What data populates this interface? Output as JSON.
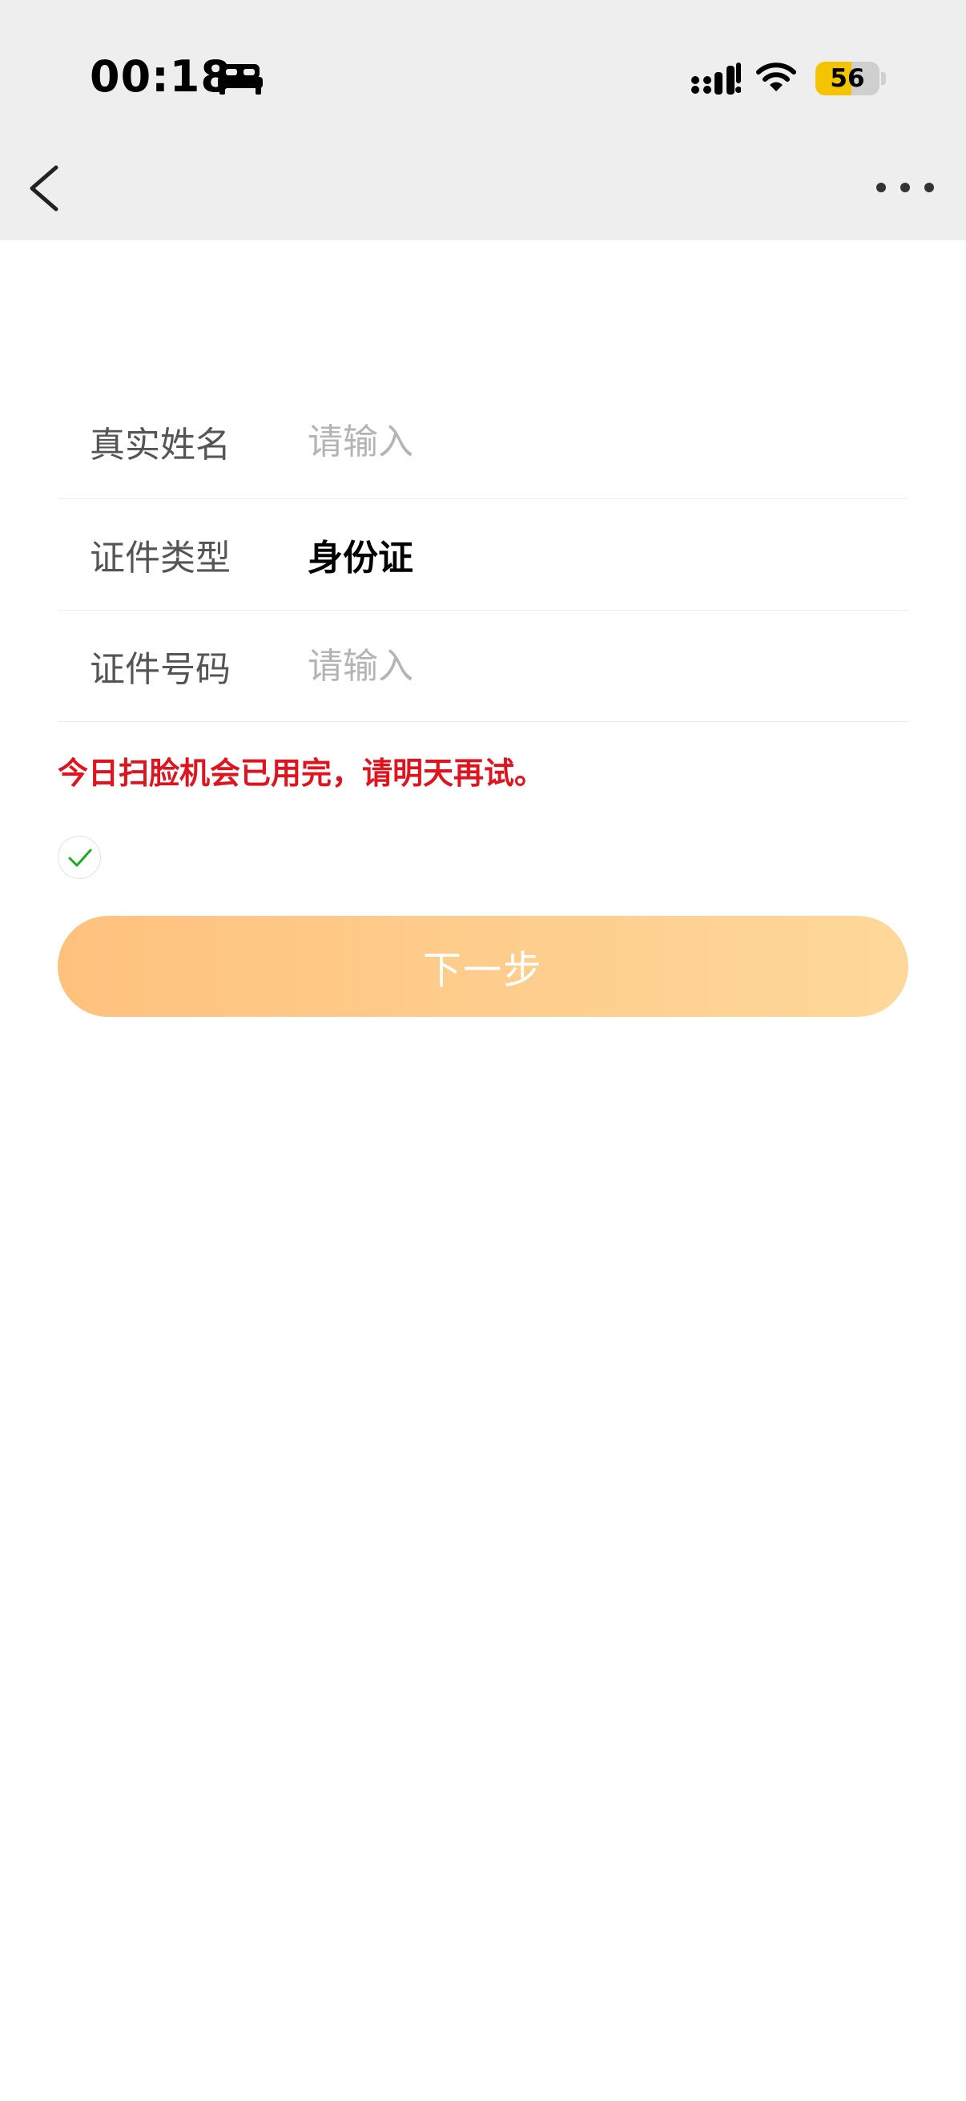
{
  "status_bar": {
    "time": "00:18",
    "battery_level": "56",
    "battery_fraction": 0.56,
    "battery_color": "#f5c400",
    "icons": [
      "bed-icon",
      "signal-icon",
      "wifi-icon",
      "battery-icon"
    ]
  },
  "nav": {
    "back_icon": "chevron-left-icon",
    "more_icon": "more-dots-icon"
  },
  "form": {
    "rows": [
      {
        "label": "真实姓名",
        "placeholder": "请输入",
        "value": ""
      },
      {
        "label": "证件类型",
        "value": "身份证"
      },
      {
        "label": "证件号码",
        "placeholder": "请输入",
        "value": ""
      }
    ]
  },
  "error_message": "今日扫脸机会已用完，请明天再试。",
  "error_color": "#e0141e",
  "agreement": {
    "checked": true,
    "check_color": "#1aad19"
  },
  "next_button": {
    "label": "下一步",
    "gradient_start": "#ffc17e",
    "gradient_end": "#fed89a"
  }
}
